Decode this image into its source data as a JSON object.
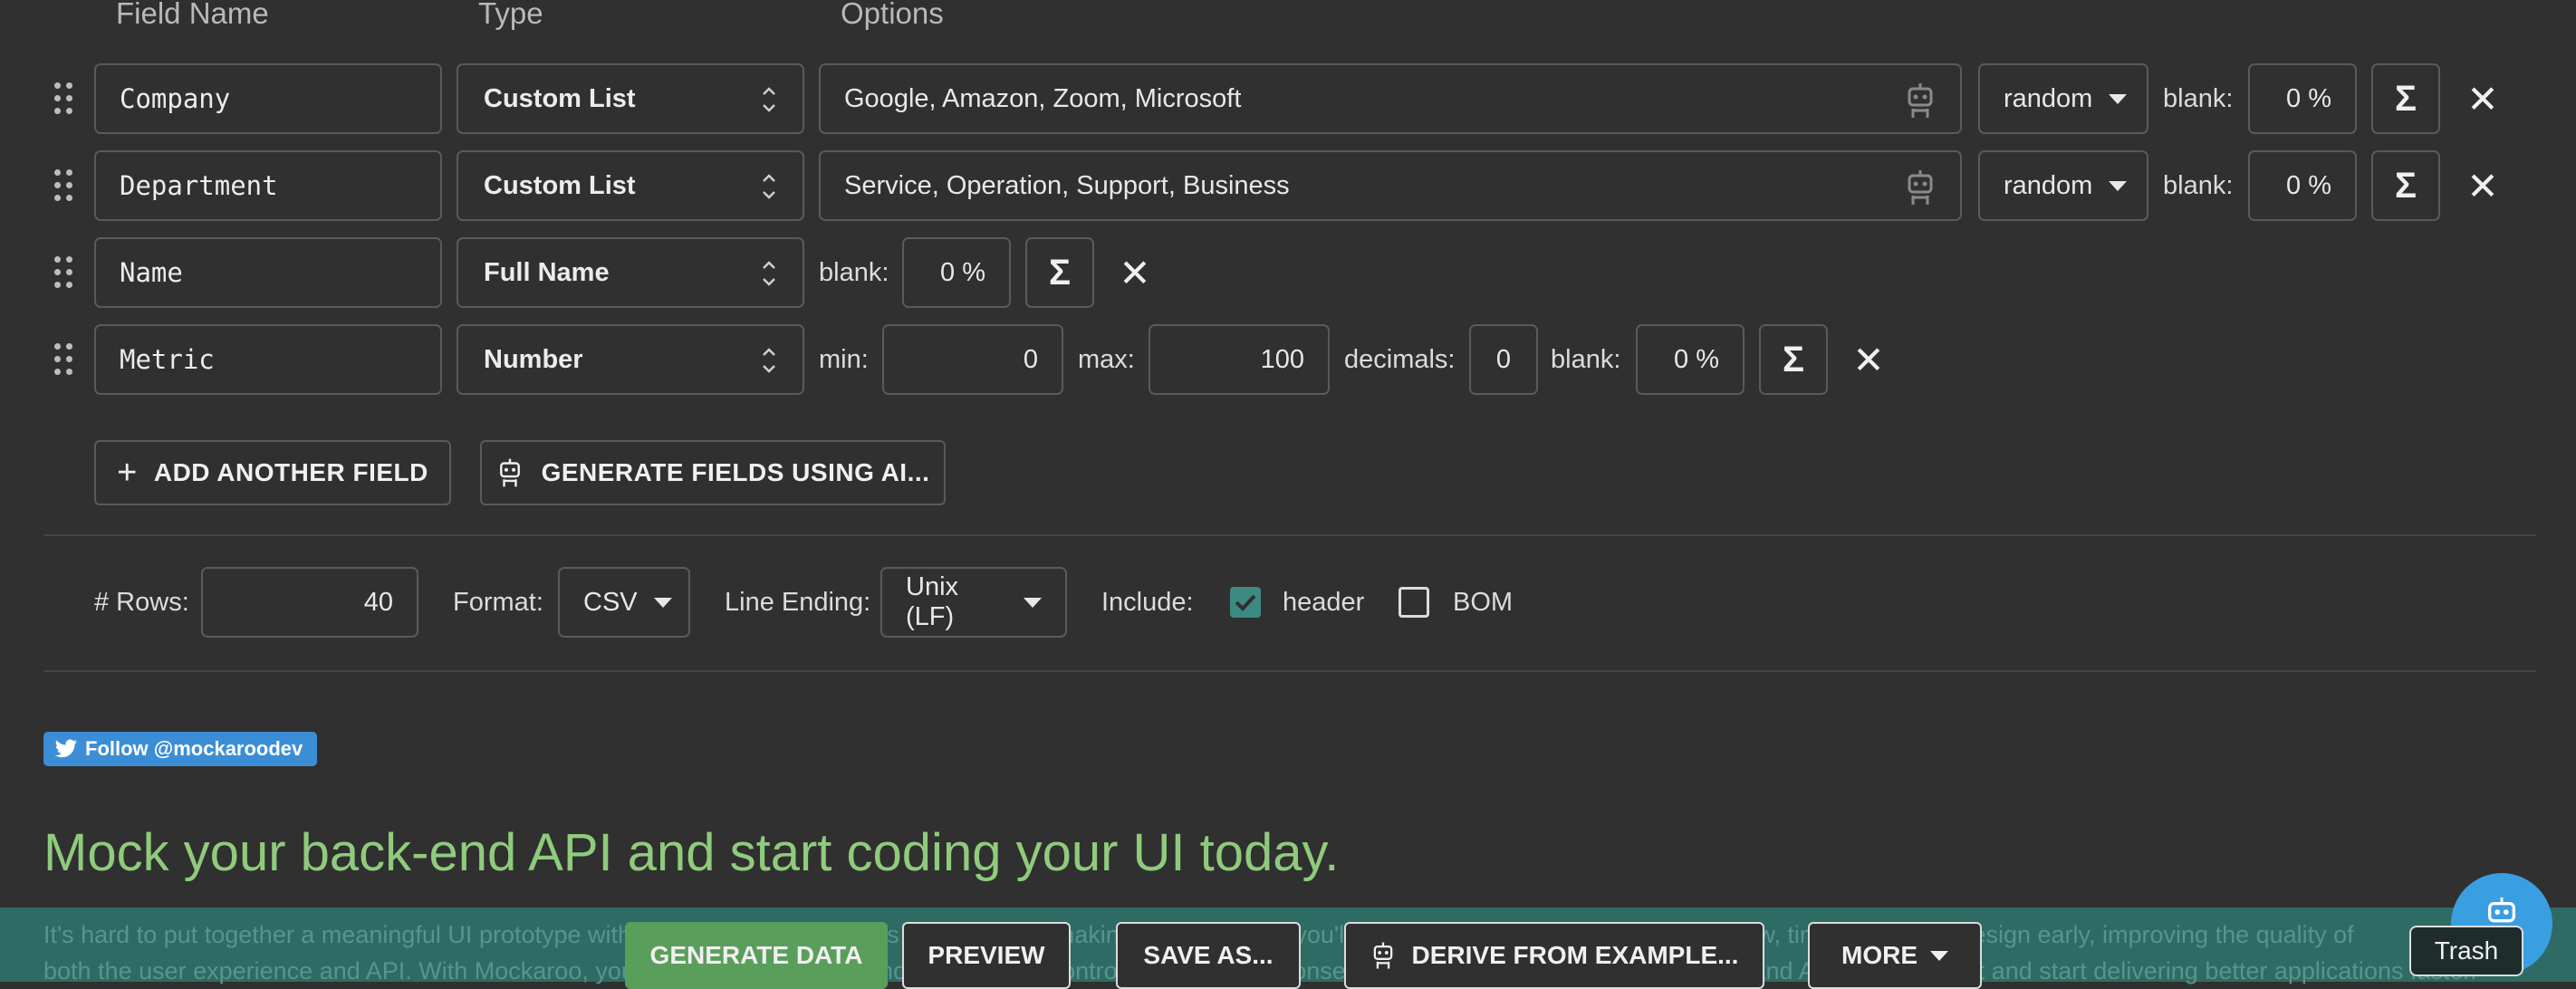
{
  "headers": {
    "field_name": "Field Name",
    "type": "Type",
    "options": "Options"
  },
  "rows": [
    {
      "name": "Company",
      "type": "Custom List",
      "options": "Google, Amazon, Zoom, Microsoft",
      "order": "random",
      "blank_label": "blank:",
      "blank": "0 %"
    },
    {
      "name": "Department",
      "type": "Custom List",
      "options": "Service, Operation, Support, Business",
      "order": "random",
      "blank_label": "blank:",
      "blank": "0 %"
    },
    {
      "name": "Name",
      "type": "Full Name",
      "blank_label": "blank:",
      "blank": "0 %"
    },
    {
      "name": "Metric",
      "type": "Number",
      "min_label": "min:",
      "min": "0",
      "max_label": "max:",
      "max": "100",
      "decimals_label": "decimals:",
      "decimals": "0",
      "blank_label": "blank:",
      "blank": "0 %"
    }
  ],
  "sigma": "Σ",
  "close": "✕",
  "buttons": {
    "add_field": "ADD ANOTHER FIELD",
    "generate_ai": "GENERATE FIELDS USING AI..."
  },
  "settings": {
    "rows_label": "# Rows:",
    "rows": "40",
    "format_label": "Format:",
    "format": "CSV",
    "line_ending_label": "Line Ending:",
    "line_ending": "Unix (LF)",
    "include_label": "Include:",
    "header_label": "header",
    "header_checked": true,
    "bom_label": "BOM",
    "bom_checked": false
  },
  "twitter": "Follow @mockaroodev",
  "headline": "Mock your back-end API and start coding your UI today.",
  "paragraph_line1": "It's hard to put together a meaningful UI prototype without making real requests to an API. By making real requests, you'll uncover problems with application flow, timing, and API design early, improving the quality of",
  "paragraph_line2": "both the user experience and API. With Mockaroo, you can design your own mock APIs. You control the URLs, responses, and error conditions. Paralellize UI and API development and start delivering better applications faster.",
  "bottom_buttons": {
    "generate": "GENERATE DATA",
    "preview": "PREVIEW",
    "save_as": "SAVE AS...",
    "derive": "DERIVE FROM EXAMPLE...",
    "more": "MORE"
  },
  "tooltip": "Trash",
  "colors": {
    "background": "#303030",
    "accent_green": "#5a9e5c",
    "headline_green": "#8fcb7c",
    "checkbox_teal": "#3d8a82",
    "chat_blue": "#3a9fe0",
    "twitter_blue": "#3b8ed6"
  }
}
